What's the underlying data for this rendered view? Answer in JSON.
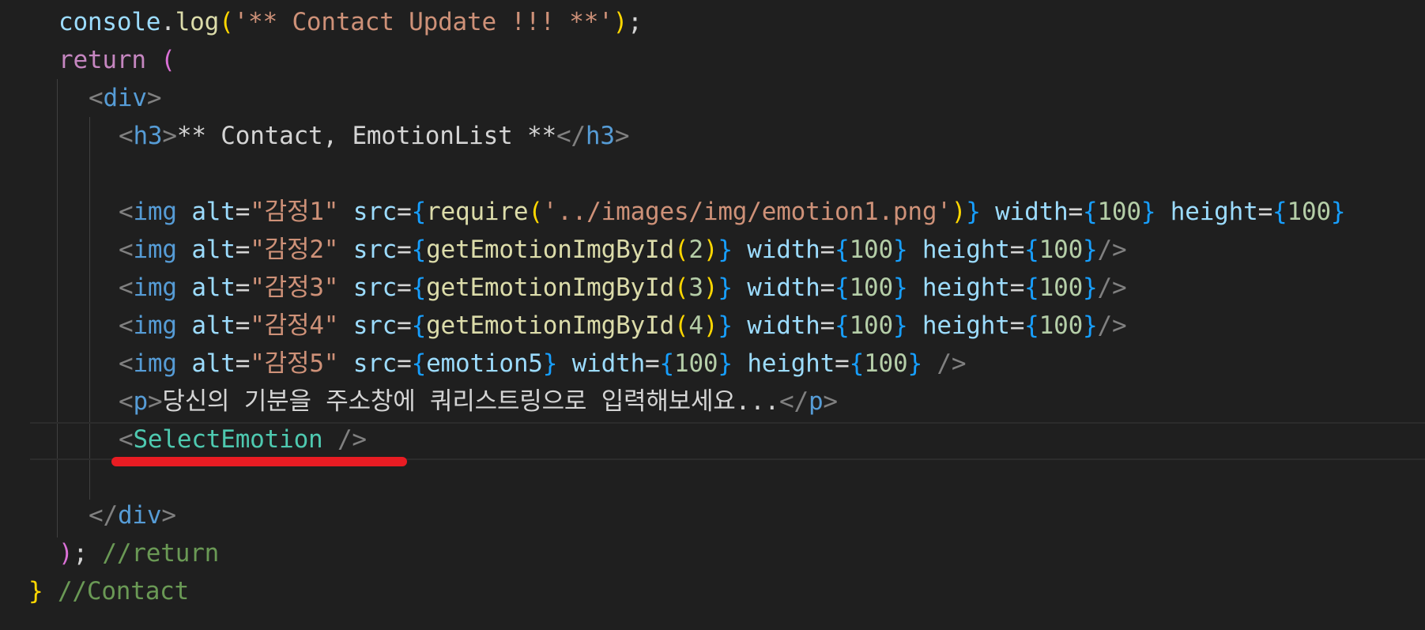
{
  "editor": {
    "theme_colors": {
      "background": "#1f1f1f",
      "variable": "#9cdcfe",
      "function": "#dcdcaa",
      "string": "#ce9178",
      "keyword": "#c586c0",
      "tag": "#569cd6",
      "component": "#4ec9b0",
      "number": "#b5cea8",
      "comment": "#6a9955",
      "annotation_underline": "#e81c23"
    },
    "lines": [
      {
        "indent": 2,
        "tokens": [
          {
            "t": "console",
            "c": "var"
          },
          {
            "t": ".",
            "c": "pu"
          },
          {
            "t": "log",
            "c": "fn"
          },
          {
            "t": "(",
            "c": "b1"
          },
          {
            "t": "'** Contact Update !!! **'",
            "c": "str"
          },
          {
            "t": ")",
            "c": "b1"
          },
          {
            "t": ";",
            "c": "pu"
          }
        ]
      },
      {
        "indent": 2,
        "tokens": [
          {
            "t": "return",
            "c": "kw"
          },
          {
            "t": " ",
            "c": "pu"
          },
          {
            "t": "(",
            "c": "b2"
          }
        ]
      },
      {
        "indent": 3,
        "tokens": [
          {
            "t": "<",
            "c": "tagb"
          },
          {
            "t": "div",
            "c": "tag"
          },
          {
            "t": ">",
            "c": "tagb"
          }
        ]
      },
      {
        "indent": 4,
        "tokens": [
          {
            "t": "<",
            "c": "tagb"
          },
          {
            "t": "h3",
            "c": "tag"
          },
          {
            "t": ">",
            "c": "tagb"
          },
          {
            "t": "** Contact, EmotionList **",
            "c": "txt"
          },
          {
            "t": "</",
            "c": "tagb"
          },
          {
            "t": "h3",
            "c": "tag"
          },
          {
            "t": ">",
            "c": "tagb"
          }
        ]
      },
      {
        "indent": 0,
        "tokens": []
      },
      {
        "indent": 4,
        "tokens": [
          {
            "t": "<",
            "c": "tagb"
          },
          {
            "t": "img",
            "c": "tag"
          },
          {
            "t": " ",
            "c": "pu"
          },
          {
            "t": "alt",
            "c": "attr"
          },
          {
            "t": "=",
            "c": "pu"
          },
          {
            "t": "\"감정1\"",
            "c": "str"
          },
          {
            "t": " ",
            "c": "pu"
          },
          {
            "t": "src",
            "c": "attr"
          },
          {
            "t": "=",
            "c": "pu"
          },
          {
            "t": "{",
            "c": "b3"
          },
          {
            "t": "require",
            "c": "fn"
          },
          {
            "t": "(",
            "c": "b1"
          },
          {
            "t": "'../images/img/emotion1.png'",
            "c": "str"
          },
          {
            "t": ")",
            "c": "b1"
          },
          {
            "t": "}",
            "c": "b3"
          },
          {
            "t": " ",
            "c": "pu"
          },
          {
            "t": "width",
            "c": "attr"
          },
          {
            "t": "=",
            "c": "pu"
          },
          {
            "t": "{",
            "c": "b3"
          },
          {
            "t": "100",
            "c": "num"
          },
          {
            "t": "}",
            "c": "b3"
          },
          {
            "t": " ",
            "c": "pu"
          },
          {
            "t": "height",
            "c": "attr"
          },
          {
            "t": "=",
            "c": "pu"
          },
          {
            "t": "{",
            "c": "b3"
          },
          {
            "t": "100",
            "c": "num"
          },
          {
            "t": "}",
            "c": "b3"
          }
        ]
      },
      {
        "indent": 4,
        "tokens": [
          {
            "t": "<",
            "c": "tagb"
          },
          {
            "t": "img",
            "c": "tag"
          },
          {
            "t": " ",
            "c": "pu"
          },
          {
            "t": "alt",
            "c": "attr"
          },
          {
            "t": "=",
            "c": "pu"
          },
          {
            "t": "\"감정2\"",
            "c": "str"
          },
          {
            "t": " ",
            "c": "pu"
          },
          {
            "t": "src",
            "c": "attr"
          },
          {
            "t": "=",
            "c": "pu"
          },
          {
            "t": "{",
            "c": "b3"
          },
          {
            "t": "getEmotionImgById",
            "c": "fn"
          },
          {
            "t": "(",
            "c": "b1"
          },
          {
            "t": "2",
            "c": "num"
          },
          {
            "t": ")",
            "c": "b1"
          },
          {
            "t": "}",
            "c": "b3"
          },
          {
            "t": " ",
            "c": "pu"
          },
          {
            "t": "width",
            "c": "attr"
          },
          {
            "t": "=",
            "c": "pu"
          },
          {
            "t": "{",
            "c": "b3"
          },
          {
            "t": "100",
            "c": "num"
          },
          {
            "t": "}",
            "c": "b3"
          },
          {
            "t": " ",
            "c": "pu"
          },
          {
            "t": "height",
            "c": "attr"
          },
          {
            "t": "=",
            "c": "pu"
          },
          {
            "t": "{",
            "c": "b3"
          },
          {
            "t": "100",
            "c": "num"
          },
          {
            "t": "}",
            "c": "b3"
          },
          {
            "t": "/>",
            "c": "tagb"
          }
        ]
      },
      {
        "indent": 4,
        "tokens": [
          {
            "t": "<",
            "c": "tagb"
          },
          {
            "t": "img",
            "c": "tag"
          },
          {
            "t": " ",
            "c": "pu"
          },
          {
            "t": "alt",
            "c": "attr"
          },
          {
            "t": "=",
            "c": "pu"
          },
          {
            "t": "\"감정3\"",
            "c": "str"
          },
          {
            "t": " ",
            "c": "pu"
          },
          {
            "t": "src",
            "c": "attr"
          },
          {
            "t": "=",
            "c": "pu"
          },
          {
            "t": "{",
            "c": "b3"
          },
          {
            "t": "getEmotionImgById",
            "c": "fn"
          },
          {
            "t": "(",
            "c": "b1"
          },
          {
            "t": "3",
            "c": "num"
          },
          {
            "t": ")",
            "c": "b1"
          },
          {
            "t": "}",
            "c": "b3"
          },
          {
            "t": " ",
            "c": "pu"
          },
          {
            "t": "width",
            "c": "attr"
          },
          {
            "t": "=",
            "c": "pu"
          },
          {
            "t": "{",
            "c": "b3"
          },
          {
            "t": "100",
            "c": "num"
          },
          {
            "t": "}",
            "c": "b3"
          },
          {
            "t": " ",
            "c": "pu"
          },
          {
            "t": "height",
            "c": "attr"
          },
          {
            "t": "=",
            "c": "pu"
          },
          {
            "t": "{",
            "c": "b3"
          },
          {
            "t": "100",
            "c": "num"
          },
          {
            "t": "}",
            "c": "b3"
          },
          {
            "t": "/>",
            "c": "tagb"
          }
        ]
      },
      {
        "indent": 4,
        "tokens": [
          {
            "t": "<",
            "c": "tagb"
          },
          {
            "t": "img",
            "c": "tag"
          },
          {
            "t": " ",
            "c": "pu"
          },
          {
            "t": "alt",
            "c": "attr"
          },
          {
            "t": "=",
            "c": "pu"
          },
          {
            "t": "\"감정4\"",
            "c": "str"
          },
          {
            "t": " ",
            "c": "pu"
          },
          {
            "t": "src",
            "c": "attr"
          },
          {
            "t": "=",
            "c": "pu"
          },
          {
            "t": "{",
            "c": "b3"
          },
          {
            "t": "getEmotionImgById",
            "c": "fn"
          },
          {
            "t": "(",
            "c": "b1"
          },
          {
            "t": "4",
            "c": "num"
          },
          {
            "t": ")",
            "c": "b1"
          },
          {
            "t": "}",
            "c": "b3"
          },
          {
            "t": " ",
            "c": "pu"
          },
          {
            "t": "width",
            "c": "attr"
          },
          {
            "t": "=",
            "c": "pu"
          },
          {
            "t": "{",
            "c": "b3"
          },
          {
            "t": "100",
            "c": "num"
          },
          {
            "t": "}",
            "c": "b3"
          },
          {
            "t": " ",
            "c": "pu"
          },
          {
            "t": "height",
            "c": "attr"
          },
          {
            "t": "=",
            "c": "pu"
          },
          {
            "t": "{",
            "c": "b3"
          },
          {
            "t": "100",
            "c": "num"
          },
          {
            "t": "}",
            "c": "b3"
          },
          {
            "t": "/>",
            "c": "tagb"
          }
        ]
      },
      {
        "indent": 4,
        "tokens": [
          {
            "t": "<",
            "c": "tagb"
          },
          {
            "t": "img",
            "c": "tag"
          },
          {
            "t": " ",
            "c": "pu"
          },
          {
            "t": "alt",
            "c": "attr"
          },
          {
            "t": "=",
            "c": "pu"
          },
          {
            "t": "\"감정5\"",
            "c": "str"
          },
          {
            "t": " ",
            "c": "pu"
          },
          {
            "t": "src",
            "c": "attr"
          },
          {
            "t": "=",
            "c": "pu"
          },
          {
            "t": "{",
            "c": "b3"
          },
          {
            "t": "emotion5",
            "c": "var"
          },
          {
            "t": "}",
            "c": "b3"
          },
          {
            "t": " ",
            "c": "pu"
          },
          {
            "t": "width",
            "c": "attr"
          },
          {
            "t": "=",
            "c": "pu"
          },
          {
            "t": "{",
            "c": "b3"
          },
          {
            "t": "100",
            "c": "num"
          },
          {
            "t": "}",
            "c": "b3"
          },
          {
            "t": " ",
            "c": "pu"
          },
          {
            "t": "height",
            "c": "attr"
          },
          {
            "t": "=",
            "c": "pu"
          },
          {
            "t": "{",
            "c": "b3"
          },
          {
            "t": "100",
            "c": "num"
          },
          {
            "t": "}",
            "c": "b3"
          },
          {
            "t": " ",
            "c": "pu"
          },
          {
            "t": "/>",
            "c": "tagb"
          }
        ]
      },
      {
        "indent": 4,
        "tokens": [
          {
            "t": "<",
            "c": "tagb"
          },
          {
            "t": "p",
            "c": "tag"
          },
          {
            "t": ">",
            "c": "tagb"
          },
          {
            "t": "당신의 기분을 주소창에 쿼리스트링으로 입력해보세요...",
            "c": "txt"
          },
          {
            "t": "</",
            "c": "tagb"
          },
          {
            "t": "p",
            "c": "tag"
          },
          {
            "t": ">",
            "c": "tagb"
          }
        ]
      },
      {
        "indent": 4,
        "tokens": [
          {
            "t": "<",
            "c": "tagb"
          },
          {
            "t": "SelectEmotion",
            "c": "comp"
          },
          {
            "t": " ",
            "c": "pu"
          },
          {
            "t": "/>",
            "c": "tagb"
          }
        ]
      },
      {
        "indent": 0,
        "tokens": []
      },
      {
        "indent": 3,
        "tokens": [
          {
            "t": "</",
            "c": "tagb"
          },
          {
            "t": "div",
            "c": "tag"
          },
          {
            "t": ">",
            "c": "tagb"
          }
        ]
      },
      {
        "indent": 2,
        "tokens": [
          {
            "t": ")",
            "c": "b2"
          },
          {
            "t": ";",
            "c": "pu"
          },
          {
            "t": " ",
            "c": "pu"
          },
          {
            "t": "//return",
            "c": "cm"
          }
        ]
      },
      {
        "indent": 1,
        "tokens": [
          {
            "t": "}",
            "c": "b1"
          },
          {
            "t": " ",
            "c": "pu"
          },
          {
            "t": "//Contact",
            "c": "cm"
          }
        ]
      }
    ]
  }
}
